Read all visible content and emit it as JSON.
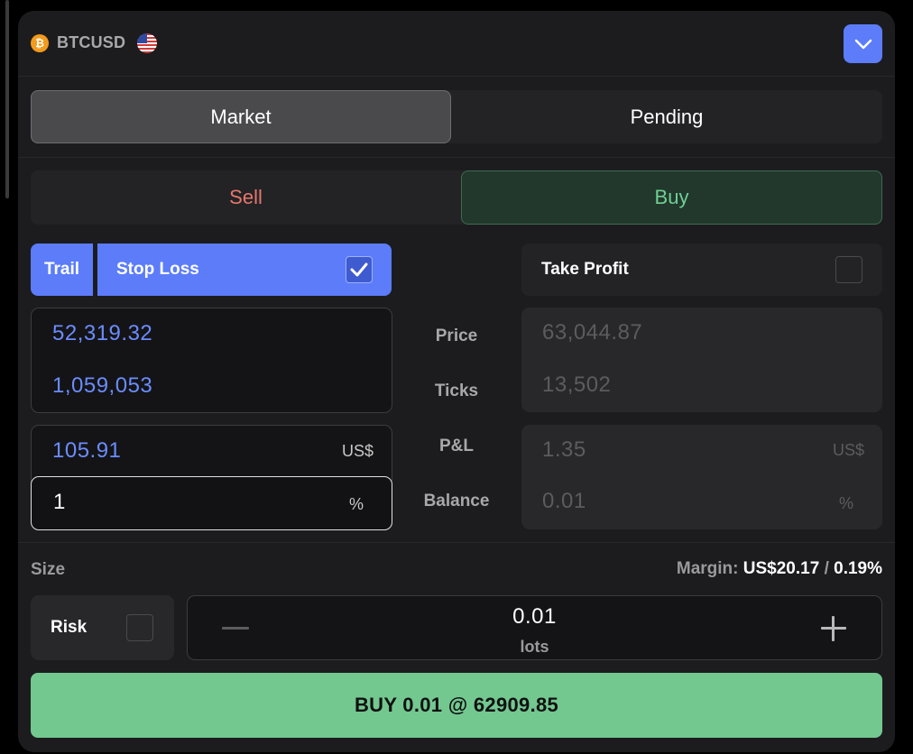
{
  "header": {
    "symbol": "BTCUSD",
    "coin_icon": "bitcoin-icon",
    "flag_icon": "us-flag-icon",
    "collapse_icon": "chevron-down-icon"
  },
  "order_type_tabs": [
    {
      "label": "Market",
      "selected": true
    },
    {
      "label": "Pending",
      "selected": false
    }
  ],
  "side_tabs": [
    {
      "label": "Sell",
      "selected": false
    },
    {
      "label": "Buy",
      "selected": true
    }
  ],
  "stop_loss": {
    "trail_label": "Trail",
    "label": "Stop Loss",
    "checked": true,
    "price": "52,319.32",
    "ticks": "1,059,053",
    "pnl": "105.91",
    "pnl_unit": "US$",
    "balance": "1",
    "balance_unit": "%"
  },
  "row_labels": {
    "price": "Price",
    "ticks": "Ticks",
    "pnl": "P&L",
    "balance": "Balance"
  },
  "take_profit": {
    "label": "Take Profit",
    "checked": false,
    "price": "63,044.87",
    "ticks": "13,502",
    "pnl": "1.35",
    "pnl_unit": "US$",
    "balance": "0.01",
    "balance_unit": "%"
  },
  "size": {
    "label": "Size",
    "margin_label": "Margin:",
    "margin_value": "US$20.17",
    "margin_sep": "/",
    "margin_pct": "0.19%",
    "risk_label": "Risk",
    "risk_checked": false,
    "lots_value": "0.01",
    "lots_unit": "lots"
  },
  "submit": {
    "label": "BUY 0.01 @ 62909.85"
  },
  "colors": {
    "accent": "#5c7cfa",
    "buy": "#73c890",
    "sell": "#e6776c",
    "panel": "#1c1c1f"
  }
}
